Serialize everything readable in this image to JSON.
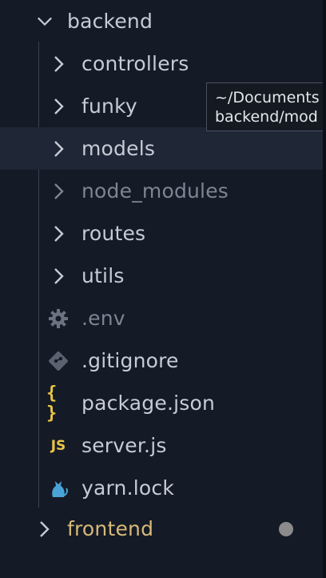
{
  "tree": {
    "root_folder": "backend",
    "folders": [
      {
        "label": "controllers"
      },
      {
        "label": "funky"
      },
      {
        "label": "models"
      },
      {
        "label": "node_modules"
      },
      {
        "label": "routes"
      },
      {
        "label": "utils"
      }
    ],
    "files": [
      {
        "label": ".env",
        "icon": "gear-icon"
      },
      {
        "label": ".gitignore",
        "icon": "git-icon"
      },
      {
        "label": "package.json",
        "icon": "json-braces-icon",
        "icon_text": "{ }"
      },
      {
        "label": "server.js",
        "icon": "js-icon",
        "icon_text": "JS"
      },
      {
        "label": "yarn.lock",
        "icon": "yarn-cat-icon"
      }
    ],
    "sibling_folder": "frontend"
  },
  "tooltip": {
    "line1": "~/Documents",
    "line2": "backend/mod"
  },
  "colors": {
    "background": "#141a26",
    "hover_row": "#1f2635",
    "text": "#c6ccd6",
    "dim_text": "#7d8593",
    "frontend_text": "#d9b978",
    "json_icon": "#e8c547",
    "js_icon": "#e8c547",
    "yarn_icon": "#4aa3d6",
    "git_icon": "#5a6270",
    "gear_icon": "#6b7380",
    "modified_dot": "#8b8b8b"
  }
}
